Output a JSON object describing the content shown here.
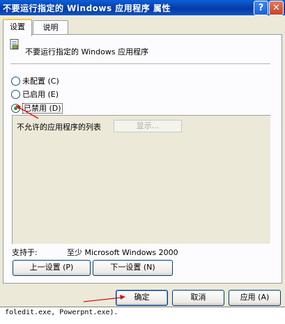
{
  "window": {
    "title": "不要运行指定的 Windows 应用程序 属性",
    "help_glyph": "?",
    "close_glyph": "✕"
  },
  "tabs": [
    {
      "label": "设置",
      "active": true
    },
    {
      "label": "说明",
      "active": false
    }
  ],
  "policy": {
    "icon": "policy-setting-icon",
    "title": "不要运行指定的 Windows 应用程序"
  },
  "options": [
    {
      "label": "未配置 (C)",
      "selected": false
    },
    {
      "label": "已启用 (E)",
      "selected": false
    },
    {
      "label": "已禁用 (D)",
      "selected": true
    }
  ],
  "settings": {
    "disallowed_list_label": "不允许的应用程序的列表",
    "show_button": "显示..."
  },
  "supported": {
    "label": "支持于:",
    "value": "至少 Microsoft Windows 2000"
  },
  "nav": {
    "previous": "上一设置 (P)",
    "next": "下一设置 (N)"
  },
  "dialog_buttons": {
    "ok": "确定",
    "cancel": "取消",
    "apply": "应用 (A)"
  },
  "background_text": "foledit.exe, Powerpnt.exe).",
  "colors": {
    "titlebar": "#0842b0",
    "annotation_arrow": "#d81010",
    "tab_highlight": "#ffc83c"
  }
}
